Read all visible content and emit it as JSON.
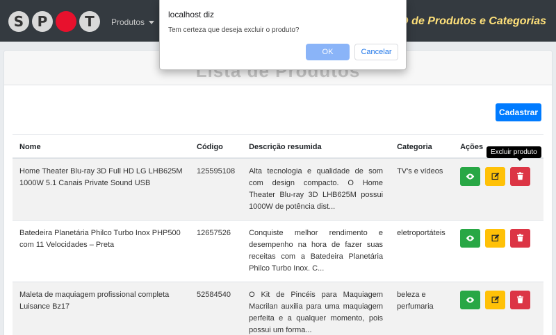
{
  "navbar": {
    "logo_letters": [
      "S",
      "P",
      "",
      "T"
    ],
    "menu_label": "Produtos",
    "title": "UD de Produtos e Categorias"
  },
  "card": {
    "title": "Lista de Produtos",
    "create_button": "Cadastrar"
  },
  "table": {
    "headers": [
      "Nome",
      "Código",
      "Descrição resumida",
      "Categoria",
      "Ações"
    ],
    "rows": [
      {
        "name": "Home Theater Blu-ray 3D Full HD LG LHB625M 1000W 5.1 Canais Private Sound USB",
        "code": "125595108",
        "description": "Alta tecnologia e qualidade de som com design compacto. O Home Theater Blu-ray 3D LHB625M possui 1000W de potência dist...",
        "category": "TV's e vídeos"
      },
      {
        "name": "Batedeira Planetária Philco Turbo Inox PHP500 com 11 Velocidades – Preta",
        "code": "12657526",
        "description": "Conquiste melhor rendimento e desempenho na hora de fazer suas receitas com a Batedeira Planetária Philco Turbo Inox. C...",
        "category": "eletroportáteis"
      },
      {
        "name": "Maleta de maquiagem profissional completa Luisance Bz17",
        "code": "52584540",
        "description": "O Kit de Pincéis para Maquiagem Macrilan auxilia para uma maquiagem perfeita e a qualquer momento, pois possui um forma...",
        "category": "beleza e perfumaria"
      }
    ]
  },
  "tooltip": "Excluir produto",
  "dialog": {
    "title": "localhost diz",
    "message": "Tem certeza que deseja excluir o produto?",
    "ok_label": "OK",
    "cancel_label": "Cancelar"
  },
  "icons": {
    "view": "eye-icon",
    "edit": "edit-icon",
    "delete": "trash-icon",
    "menu_caret": "chevron-down-icon"
  },
  "colors": {
    "navbar": "#343a40",
    "title_accent": "#ffe17a",
    "primary": "#007bff",
    "view": "#28a745",
    "edit": "#ffc107",
    "delete": "#dc3545",
    "logo_dot": "#e8112d"
  }
}
